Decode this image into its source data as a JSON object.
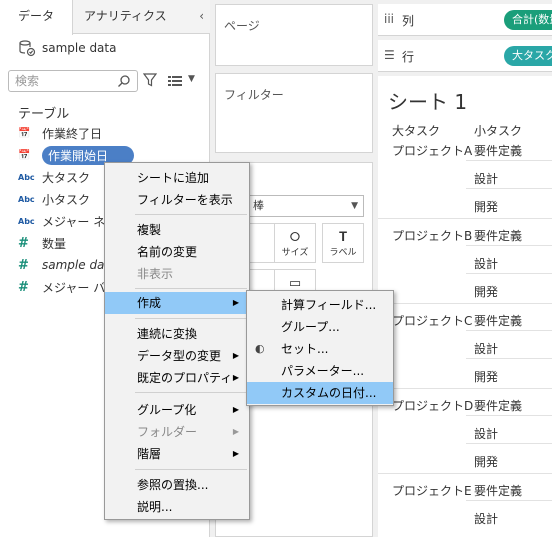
{
  "left_pane": {
    "tabs": {
      "data": "データ",
      "analytics": "アナリティクス"
    },
    "datasource": "sample data",
    "search_placeholder": "検索",
    "tables_header": "テーブル",
    "fields": [
      {
        "label": "作業終了日",
        "icon": "calendar-icon"
      },
      {
        "label": "作業開始日",
        "icon": "calendar-icon"
      },
      {
        "label": "大タスク",
        "icon": "Abc"
      },
      {
        "label": "小タスク",
        "icon": "Abc"
      },
      {
        "label": "メジャー ネーム",
        "icon": "Abc"
      },
      {
        "label": "数量",
        "icon": "#"
      },
      {
        "label": "sample data",
        "icon": "#"
      },
      {
        "label": "メジャー バリュー",
        "icon": "#"
      }
    ]
  },
  "shelves": {
    "pages": "ページ",
    "filters": "フィルター",
    "marks_type": "棒",
    "marks_buttons": {
      "size": "サイズ",
      "label": "ラベル"
    }
  },
  "worksheet": {
    "columns_label": "列",
    "rows_label": "行",
    "columns_pill": "合計(数量)",
    "rows_pill": "大タスク",
    "sheet_title": "シート 1",
    "headers": [
      "大タスク",
      "小タスク"
    ],
    "groups": [
      {
        "name": "プロジェクトA",
        "items": [
          "要件定義",
          "設計",
          "開発"
        ]
      },
      {
        "name": "プロジェクトB",
        "items": [
          "要件定義",
          "設計",
          "開発"
        ]
      },
      {
        "name": "プロジェクトC",
        "items": [
          "要件定義",
          "設計",
          "開発"
        ]
      },
      {
        "name": "プロジェクトD",
        "items": [
          "要件定義",
          "設計",
          "開発"
        ]
      },
      {
        "name": "プロジェクトE",
        "items": [
          "要件定義",
          "設計"
        ]
      }
    ]
  },
  "context_menu": {
    "items": [
      {
        "label": "シートに追加"
      },
      {
        "label": "フィルターを表示"
      },
      {
        "label": "複製"
      },
      {
        "label": "名前の変更"
      },
      {
        "label": "非表示",
        "disabled": true
      },
      {
        "label": "作成",
        "submenu": true,
        "highlighted": true
      },
      {
        "label": "連続に変換"
      },
      {
        "label": "データ型の変更",
        "submenu": true
      },
      {
        "label": "既定のプロパティ",
        "submenu": true
      },
      {
        "label": "グループ化",
        "submenu": true
      },
      {
        "label": "フォルダー",
        "submenu": true,
        "disabled": true
      },
      {
        "label": "階層",
        "submenu": true
      },
      {
        "label": "参照の置換..."
      },
      {
        "label": "説明..."
      }
    ]
  },
  "submenu": {
    "items": [
      {
        "label": "計算フィールド..."
      },
      {
        "label": "グループ..."
      },
      {
        "label": "セット..."
      },
      {
        "label": "パラメーター..."
      },
      {
        "label": "カスタムの日付...",
        "highlighted": true
      }
    ]
  },
  "colors": {
    "selected_field": "#4b7fc6",
    "menu_highlight": "#91c9f7",
    "columns_pill": "#1a9e7a",
    "rows_pill": "#2aa7a7"
  }
}
